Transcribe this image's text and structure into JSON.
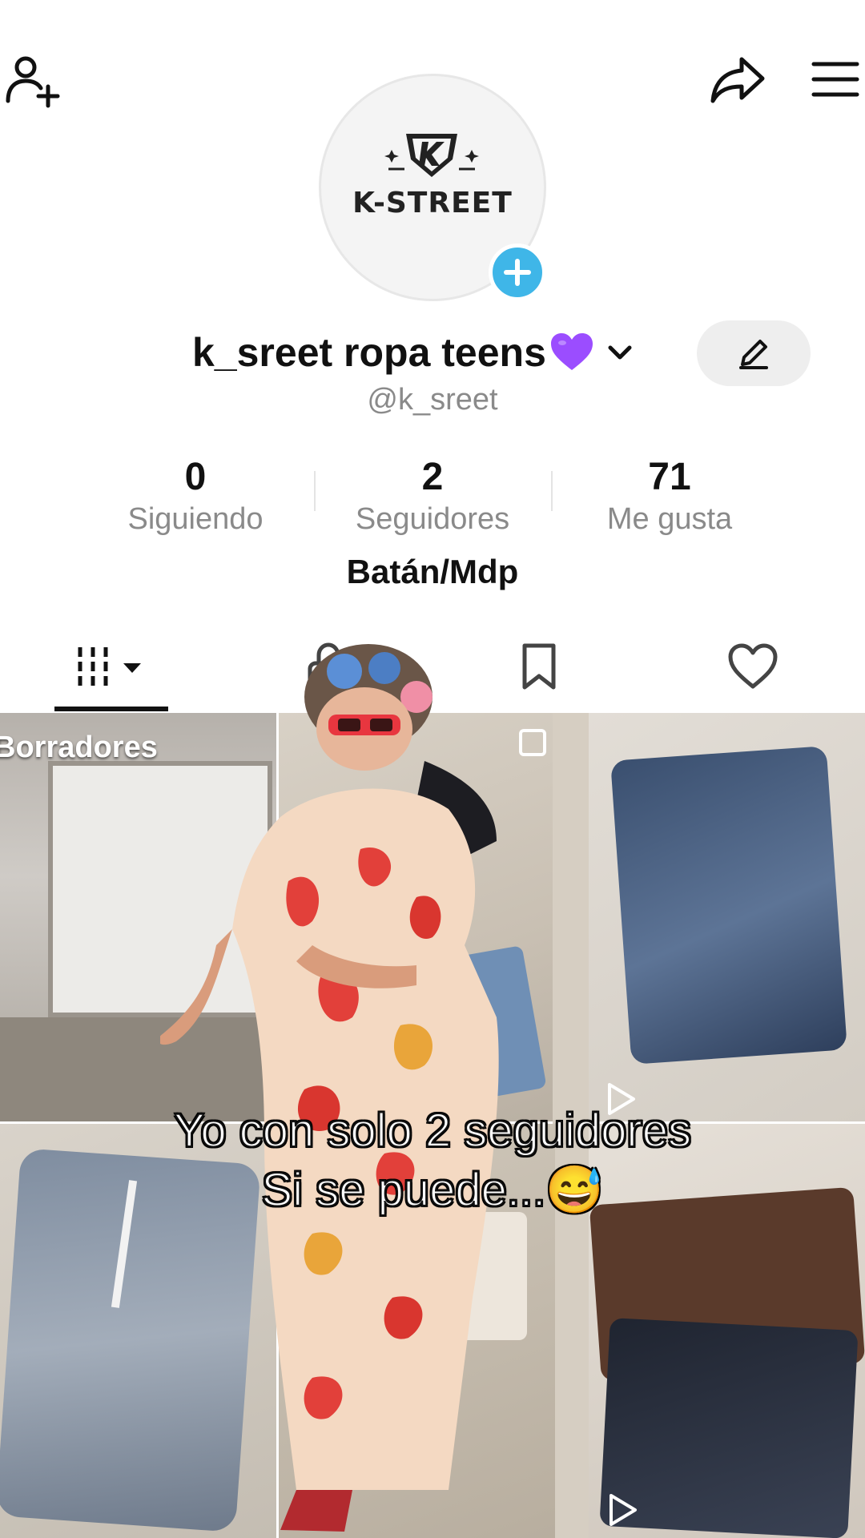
{
  "profile": {
    "logo_text": "K-STREET",
    "display_name": "k_sreet ropa teens",
    "username": "@k_sreet",
    "bio": "Batán/Mdp",
    "name_emoji": "purple-heart-icon"
  },
  "stats": [
    {
      "value": "0",
      "label": "Siguiendo"
    },
    {
      "value": "2",
      "label": "Seguidores"
    },
    {
      "value": "71",
      "label": "Me gusta"
    }
  ],
  "tabs": [
    {
      "name": "videos",
      "icon": "grid-icon",
      "active": true
    },
    {
      "name": "private",
      "icon": "lock-icon"
    },
    {
      "name": "saved",
      "icon": "bookmark-icon"
    },
    {
      "name": "liked",
      "icon": "heart-icon"
    }
  ],
  "grid": {
    "drafts_label": "Borradores"
  },
  "caption": {
    "line1": "Yo con solo 2 seguidores",
    "line2": "Si se puede...😅"
  },
  "colors": {
    "accent_blue": "#3fb6e8",
    "heart_purple": "#9b4dff"
  }
}
